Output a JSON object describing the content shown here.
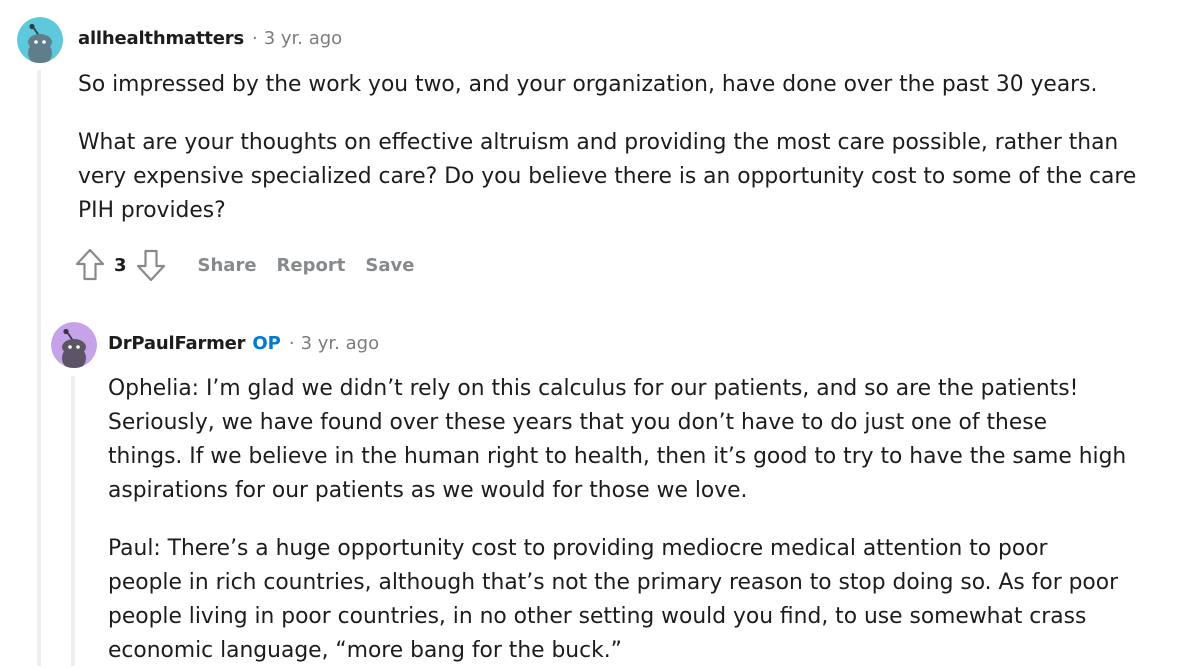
{
  "comment1": {
    "author": "allhealthmatters",
    "separator": "·",
    "time": "3 yr. ago",
    "avatar_color": "#5ec8dc",
    "paragraphs": [
      "So impressed by the work you two, and your organization, have done over the past 30 years.",
      "What are your thoughts on effective altruism and providing the most care possible, rather than very expensive specialized care? Do you believe there is an opportunity cost to some of the care PIH provides?"
    ],
    "actions": {
      "upvote_icon": "upvote-arrow-icon",
      "score": "3",
      "downvote_icon": "downvote-arrow-icon",
      "share": "Share",
      "report": "Report",
      "save": "Save"
    }
  },
  "comment2": {
    "author": "DrPaulFarmer",
    "op_badge": "OP",
    "separator": "·",
    "time": "3 yr. ago",
    "avatar_color": "#c6a3e8",
    "paragraphs": [
      "Ophelia: I’m glad we didn’t rely on this calculus for our patients, and so are the patients! Seriously, we have found over these years that you don’t have to do just one of these things. If we believe in the human right to health, then it’s good to try to have the same high aspirations for our patients as we would for those we love.",
      "Paul: There’s a huge opportunity cost to providing mediocre medical attention to poor people in rich countries, although that’s not the primary reason to stop doing so. As for poor people living in poor countries, in no other setting would you find, to use somewhat crass economic language, “more bang for the buck.”"
    ]
  },
  "colors": {
    "text": "#1c1c1c",
    "meta": "#7c7c7c",
    "action": "#878a8c",
    "op": "#0079d3",
    "thread_line": "#edeff1"
  }
}
